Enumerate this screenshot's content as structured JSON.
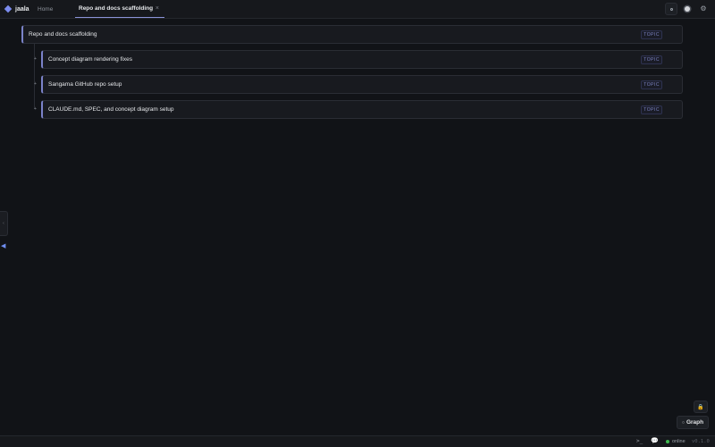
{
  "app": {
    "name": "jaala"
  },
  "tabs": {
    "home_label": "Home",
    "active_label": "Repo and docs scaffolding",
    "close_glyph": "×"
  },
  "top_actions": {
    "settings_glyph": "⚙"
  },
  "root_topic": {
    "title": "Repo and docs scaffolding",
    "badge": "TOPIC"
  },
  "child_topics": [
    {
      "title": "Concept diagram rendering fixes",
      "badge": "TOPIC",
      "toggle": "+"
    },
    {
      "title": "Sangama GitHub repo setup",
      "badge": "TOPIC",
      "toggle": "+"
    },
    {
      "title": "CLAUDE.md, SPEC, and concept diagram setup",
      "badge": "TOPIC",
      "toggle": "+"
    }
  ],
  "side": {
    "handle_glyph": "‹",
    "arrow_glyph": "◀"
  },
  "bottom": {
    "lock_glyph": "🔒",
    "graph_icon": "○",
    "graph_label": "Graph"
  },
  "statusbar": {
    "terminal_glyph": ">_",
    "chat_glyph": "💬",
    "status_text": "online",
    "version": "v0.1.0"
  },
  "colors": {
    "accent": "#7b83c9",
    "online": "#3fb950",
    "background": "#111317"
  }
}
